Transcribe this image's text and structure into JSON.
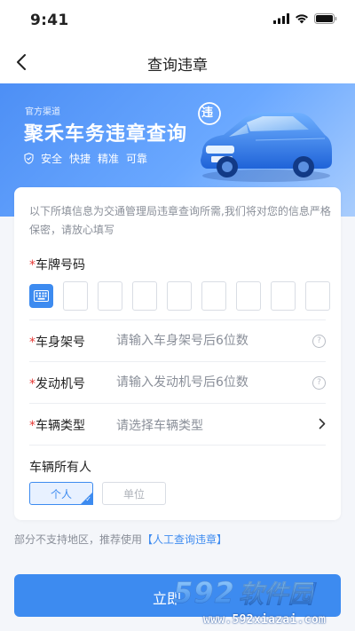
{
  "status_bar": {
    "time": "9:41"
  },
  "nav": {
    "title": "查询违章"
  },
  "banner": {
    "subtitle": "官方渠道",
    "title": "聚禾车务违章查询",
    "tags": [
      "安全",
      "快捷",
      "精准",
      "可靠"
    ],
    "badge_char": "违"
  },
  "form": {
    "notice": "以下所填信息为交通管理局违章查询所需,我们将对您的信息严格保密，请放心填写",
    "plate_label": "车牌号码",
    "required_mark": "*",
    "frame_label": "车身架号",
    "frame_placeholder": "请输入车身架号后6位数",
    "engine_label": "发动机号",
    "engine_placeholder": "请输入发动机号后6位数",
    "vehicle_type_label": "车辆类型",
    "vehicle_type_placeholder": "请选择车辆类型",
    "help_glyph": "?",
    "owner_label": "车辆所有人",
    "owner_options": [
      "个人",
      "单位"
    ],
    "owner_selected": "个人"
  },
  "footer": {
    "note": "部分不支持地区，推荐使用",
    "link": "【人工查询违章】"
  },
  "submit": {
    "label": "立即"
  },
  "watermark": {
    "numbers": "592",
    "text": "软件园",
    "url": "www.592xiazai.com"
  },
  "colors": {
    "primary": "#3d8bf0",
    "required": "#e53935",
    "background": "#f4f6fa"
  }
}
